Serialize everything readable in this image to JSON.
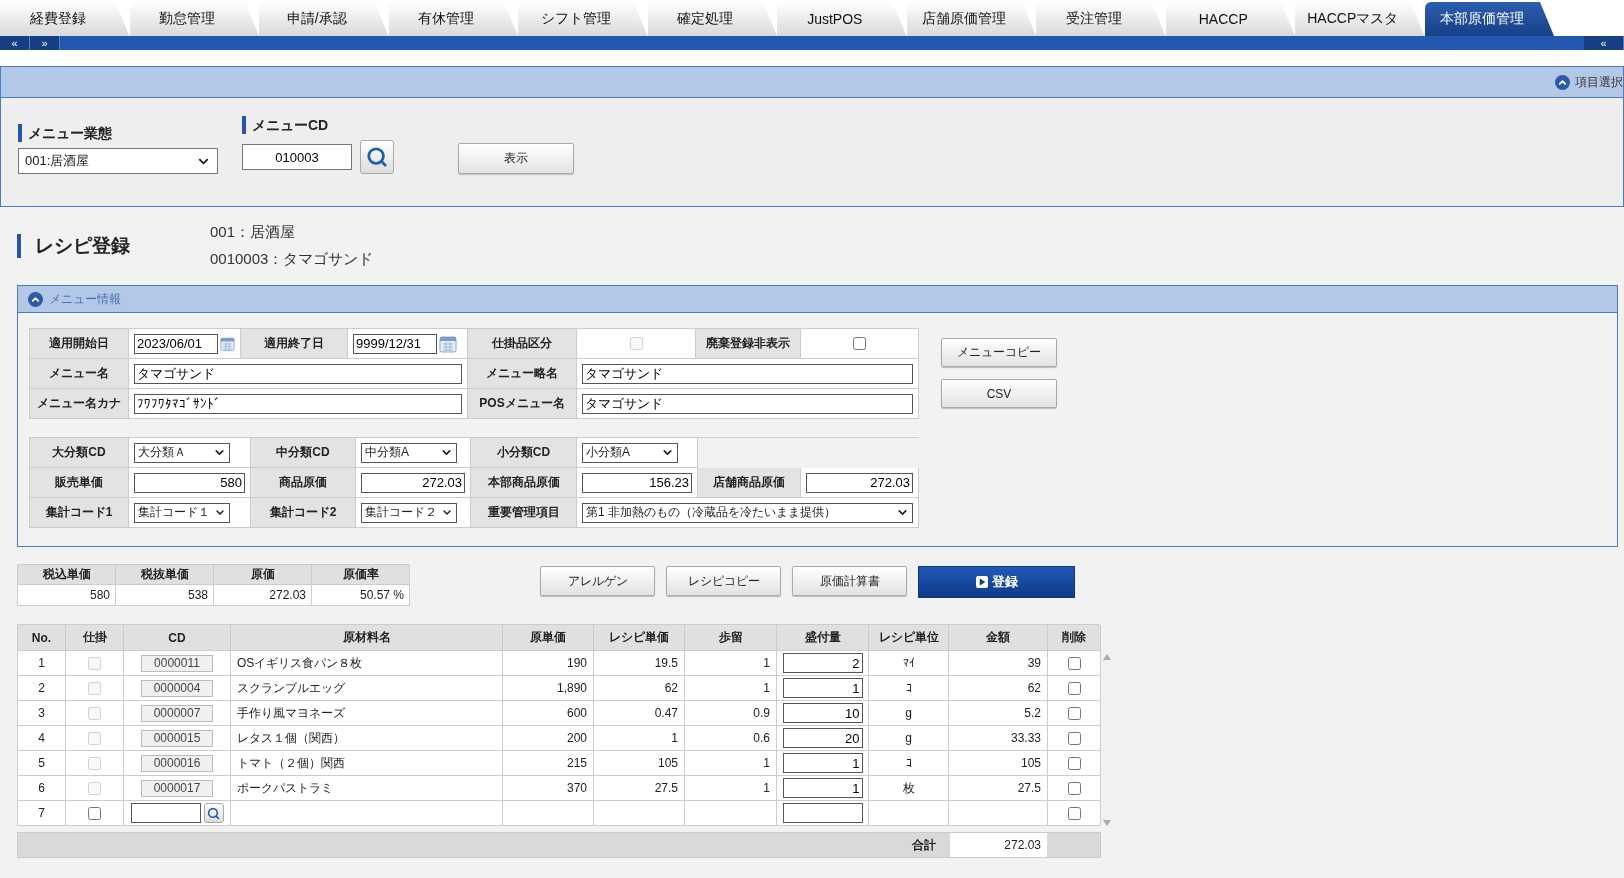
{
  "tabs": [
    {
      "label": "経費登録",
      "selected": false
    },
    {
      "label": "勤怠管理",
      "selected": false
    },
    {
      "label": "申請/承認",
      "selected": false
    },
    {
      "label": "有休管理",
      "selected": false
    },
    {
      "label": "シフト管理",
      "selected": false
    },
    {
      "label": "確定処理",
      "selected": false
    },
    {
      "label": "JustPOS",
      "selected": false
    },
    {
      "label": "店舗原価管理",
      "selected": false
    },
    {
      "label": "受注管理",
      "selected": false
    },
    {
      "label": "HACCP",
      "selected": false
    },
    {
      "label": "HACCPマスタ",
      "selected": false
    },
    {
      "label": "本部原価管理",
      "selected": true
    }
  ],
  "nav_bar": {
    "prev": "«",
    "next": "»",
    "collapse": "«"
  },
  "search": {
    "header_link": "項目選択",
    "business_type": {
      "label": "メニュー業態",
      "value": "001:居酒屋"
    },
    "menu_cd": {
      "label": "メニューCD",
      "value": "010003"
    },
    "show_button": "表示"
  },
  "recipe": {
    "title": "レシピ登録",
    "lines": [
      "001：居酒屋",
      "0010003：タマゴサンド"
    ]
  },
  "menu_info": {
    "title": "メニュー情報",
    "forms": [
      [
        [
          {
            "label": "適用開始日",
            "kind": "date",
            "value": "2023/06/01"
          },
          {
            "label": "適用終了日",
            "kind": "date",
            "value": "9999/12/31"
          },
          {
            "label": "仕掛品区分",
            "kind": "checkbox",
            "checked": false,
            "disabled": true
          },
          {
            "label": "廃棄登録非表示",
            "kind": "checkbox",
            "checked": false,
            "disabled": false
          }
        ],
        [
          {
            "label": "メニュー名",
            "kind": "text",
            "value": "タマゴサンド"
          },
          {
            "label": "メニュー略名",
            "kind": "text",
            "value": "タマゴサンド"
          }
        ],
        [
          {
            "label": "メニュー名カナ",
            "kind": "text",
            "value": "ﾌﾜﾌﾜﾀﾏｺﾞｻﾝﾄﾞ"
          },
          {
            "label": "POSメニュー名",
            "kind": "text",
            "value": "タマゴサンド"
          }
        ]
      ],
      [
        [
          {
            "label": "大分類CD",
            "kind": "select",
            "value": "大分類Ａ"
          },
          {
            "label": "中分類CD",
            "kind": "select",
            "value": "中分類A"
          },
          {
            "label": "小分類CD",
            "kind": "select",
            "value": "小分類A"
          }
        ],
        [
          {
            "label": "販売単価",
            "kind": "number",
            "value": "580"
          },
          {
            "label": "商品原価",
            "kind": "number",
            "value": "272.03"
          },
          {
            "label": "本部商品原価",
            "kind": "number",
            "value": "156.23"
          },
          {
            "label": "店舗商品原価",
            "kind": "number",
            "value": "272.03"
          }
        ],
        [
          {
            "label": "集計コード1",
            "kind": "select",
            "value": "集計コード１"
          },
          {
            "label": "集計コード2",
            "kind": "select",
            "value": "集計コード２"
          },
          {
            "label": "重要管理項目",
            "kind": "select",
            "value": "第1 非加熱のもの（冷蔵品を冷たいまま提供）"
          }
        ]
      ]
    ],
    "side_buttons": [
      "メニューコピー",
      "CSV"
    ]
  },
  "summary": {
    "columns": [
      "税込単価",
      "税抜単価",
      "原価",
      "原価率"
    ],
    "values": [
      "580",
      "538",
      "272.03",
      "50.57 %"
    ]
  },
  "actions": [
    {
      "label": "アレルゲン",
      "kind": "default"
    },
    {
      "label": "レシピコピー",
      "kind": "default"
    },
    {
      "label": "原価計算書",
      "kind": "default"
    },
    {
      "label": "登録",
      "kind": "primary"
    }
  ],
  "table": {
    "columns": [
      "No.",
      "仕掛",
      "CD",
      "原材料名",
      "原単価",
      "レシピ単価",
      "歩留",
      "盛付量",
      "レシピ単位",
      "金額",
      "削除"
    ],
    "rows": [
      {
        "kind": "item",
        "no": "1",
        "wip": {
          "checked": false,
          "disabled": true
        },
        "cd": "0000011",
        "name": "OSイギリス食パン８枚",
        "unit_price": "190",
        "recipe_price": "19.5",
        "yield": "1",
        "qty": "2",
        "recipe_unit": "ﾏｲ",
        "amount": "39",
        "delete": false
      },
      {
        "kind": "item",
        "no": "2",
        "wip": {
          "checked": false,
          "disabled": true
        },
        "cd": "0000004",
        "name": "スクランブルエッグ",
        "unit_price": "1,890",
        "recipe_price": "62",
        "yield": "1",
        "qty": "1",
        "recipe_unit": "ｺ",
        "amount": "62",
        "delete": false
      },
      {
        "kind": "item",
        "no": "3",
        "wip": {
          "checked": false,
          "disabled": true
        },
        "cd": "0000007",
        "name": "手作り風マヨネーズ",
        "unit_price": "600",
        "recipe_price": "0.47",
        "yield": "0.9",
        "qty": "10",
        "recipe_unit": "g",
        "amount": "5.2",
        "delete": false
      },
      {
        "kind": "item",
        "no": "4",
        "wip": {
          "checked": false,
          "disabled": true
        },
        "cd": "0000015",
        "name": "レタス１個（関西）",
        "unit_price": "200",
        "recipe_price": "1",
        "yield": "0.6",
        "qty": "20",
        "recipe_unit": "g",
        "amount": "33.33",
        "delete": false
      },
      {
        "kind": "item",
        "no": "5",
        "wip": {
          "checked": false,
          "disabled": true
        },
        "cd": "0000016",
        "name": "トマト（２個）関西",
        "unit_price": "215",
        "recipe_price": "105",
        "yield": "1",
        "qty": "1",
        "recipe_unit": "ｺ",
        "amount": "105",
        "delete": false
      },
      {
        "kind": "item",
        "no": "6",
        "wip": {
          "checked": false,
          "disabled": true
        },
        "cd": "0000017",
        "name": "ポークパストラミ",
        "unit_price": "370",
        "recipe_price": "27.5",
        "yield": "1",
        "qty": "1",
        "recipe_unit": "枚",
        "amount": "27.5",
        "delete": false
      },
      {
        "kind": "entry",
        "no": "7",
        "wip": {
          "checked": false,
          "disabled": false
        },
        "delete": false
      }
    ],
    "total": {
      "label": "合計",
      "value": "272.03"
    }
  }
}
